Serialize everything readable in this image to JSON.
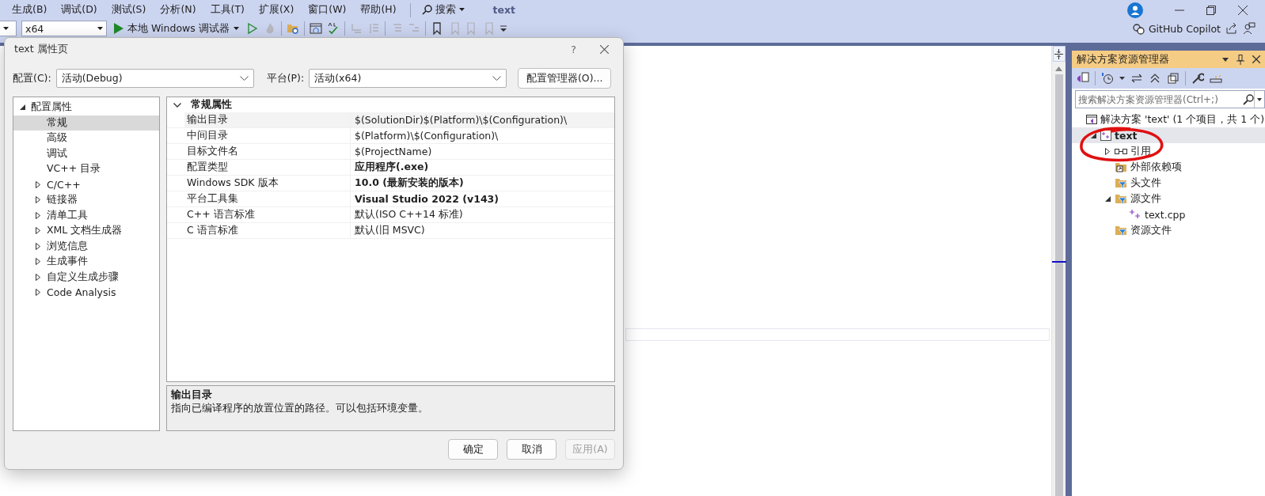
{
  "menu": [
    "生成(B)",
    "调试(D)",
    "测试(S)",
    "分析(N)",
    "工具(T)",
    "扩展(X)",
    "窗口(W)",
    "帮助(H)"
  ],
  "search": "搜索",
  "solution_name": "text",
  "toolbar": {
    "platform": "x64",
    "debugger": "本地 Windows 调试器",
    "copilot": "GitHub Copilot"
  },
  "dialog": {
    "title": "text 属性页",
    "help": "?",
    "config_label": "配置(C):",
    "config_value": "活动(Debug)",
    "platform_label": "平台(P):",
    "platform_value": "活动(x64)",
    "manager_button": "配置管理器(O)...",
    "tree": [
      {
        "label": "配置属性",
        "kind": "group",
        "expanded": true,
        "selected": false,
        "children": [
          {
            "label": "常规",
            "kind": "leaf",
            "selected": true
          },
          {
            "label": "高级",
            "kind": "leaf",
            "selected": false
          },
          {
            "label": "调试",
            "kind": "leaf",
            "selected": false
          },
          {
            "label": "VC++ 目录",
            "kind": "leaf",
            "selected": false
          },
          {
            "label": "C/C++",
            "kind": "group",
            "expanded": false,
            "selected": false
          },
          {
            "label": "链接器",
            "kind": "group",
            "expanded": false,
            "selected": false
          },
          {
            "label": "清单工具",
            "kind": "group",
            "expanded": false,
            "selected": false
          },
          {
            "label": "XML 文档生成器",
            "kind": "group",
            "expanded": false,
            "selected": false
          },
          {
            "label": "浏览信息",
            "kind": "group",
            "expanded": false,
            "selected": false
          },
          {
            "label": "生成事件",
            "kind": "group",
            "expanded": false,
            "selected": false
          },
          {
            "label": "自定义生成步骤",
            "kind": "group",
            "expanded": false,
            "selected": false
          },
          {
            "label": "Code Analysis",
            "kind": "group",
            "expanded": false,
            "selected": false
          }
        ]
      }
    ],
    "grid": {
      "section": "常规属性",
      "expanded": true,
      "rows": [
        {
          "name": "输出目录",
          "value": "$(SolutionDir)$(Platform)\\$(Configuration)\\",
          "bold": false,
          "selected": true
        },
        {
          "name": "中间目录",
          "value": "$(Platform)\\$(Configuration)\\",
          "bold": false,
          "selected": false
        },
        {
          "name": "目标文件名",
          "value": "$(ProjectName)",
          "bold": false,
          "selected": false
        },
        {
          "name": "配置类型",
          "value": "应用程序(.exe)",
          "bold": true,
          "selected": false
        },
        {
          "name": "Windows SDK 版本",
          "value": "10.0 (最新安装的版本)",
          "bold": true,
          "selected": false
        },
        {
          "name": "平台工具集",
          "value": "Visual Studio 2022 (v143)",
          "bold": true,
          "selected": false
        },
        {
          "name": "C++ 语言标准",
          "value": "默认(ISO C++14 标准)",
          "bold": false,
          "selected": false
        },
        {
          "name": "C 语言标准",
          "value": "默认(旧 MSVC)",
          "bold": false,
          "selected": false
        }
      ]
    },
    "description": {
      "title": "输出目录",
      "text": "指向已编译程序的放置位置的路径。可以包括环境变量。"
    },
    "buttons": [
      {
        "label": "确定",
        "disabled": false
      },
      {
        "label": "取消",
        "disabled": false
      },
      {
        "label": "应用(A)",
        "disabled": true
      }
    ]
  },
  "explorer": {
    "title": "解决方案资源管理器",
    "search_placeholder": "搜索解决方案资源管理器(Ctrl+;)",
    "tree": [
      {
        "label": "解决方案 'text' (1 个项目，共 1 个)",
        "kind": "solution",
        "selected": false,
        "children": [
          {
            "label": "text",
            "kind": "project",
            "expanded": true,
            "selected": true,
            "children": [
              {
                "label": "引用",
                "kind": "references",
                "expanded": false,
                "selected": false
              },
              {
                "label": "外部依赖项",
                "kind": "external",
                "selected": false
              },
              {
                "label": "头文件",
                "kind": "filter",
                "selected": false
              },
              {
                "label": "源文件",
                "kind": "filter",
                "expanded": true,
                "selected": false,
                "children": [
                  {
                    "label": "text.cpp",
                    "kind": "cpp",
                    "selected": false
                  }
                ]
              },
              {
                "label": "资源文件",
                "kind": "filter",
                "selected": false
              }
            ]
          }
        ]
      }
    ]
  }
}
